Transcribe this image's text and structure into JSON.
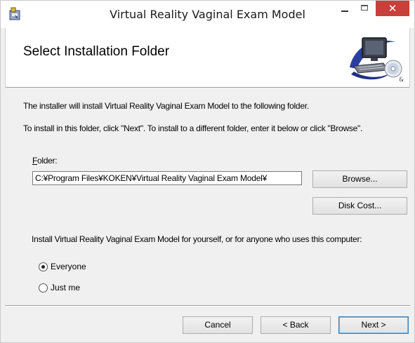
{
  "window": {
    "title": "Virtual Reality Vaginal Exam Model",
    "minimize_icon": "minimize-icon",
    "maximize_icon": "maximize-icon",
    "close_label": "✕"
  },
  "header": {
    "title": "Select Installation Folder",
    "art_icon": "computer-cd-icon"
  },
  "body": {
    "line1": "The installer will install Virtual Reality Vaginal Exam Model to the following folder.",
    "line2": "To install in this folder, click \"Next\". To install to a different folder, enter it below or click \"Browse\".",
    "folder_label_accel": "F",
    "folder_label_rest": "older:",
    "folder_value": "C:¥Program Files¥KOKEN¥Virtual Reality Vaginal Exam Model¥",
    "browse_label": "Browse...",
    "disk_cost_label": "Disk Cost...",
    "install_for_prompt": "Install Virtual Reality Vaginal Exam Model for yourself, or for anyone who uses this computer:",
    "options": [
      {
        "label": "Everyone",
        "selected": true
      },
      {
        "label": "Just me",
        "selected": false
      }
    ]
  },
  "footer": {
    "cancel_label": "Cancel",
    "back_label": "< Back",
    "next_label": "Next >"
  },
  "colors": {
    "close_button": "#c7403a",
    "dialog_bg": "#f0f0f0",
    "banner_bg": "#ffffff"
  }
}
